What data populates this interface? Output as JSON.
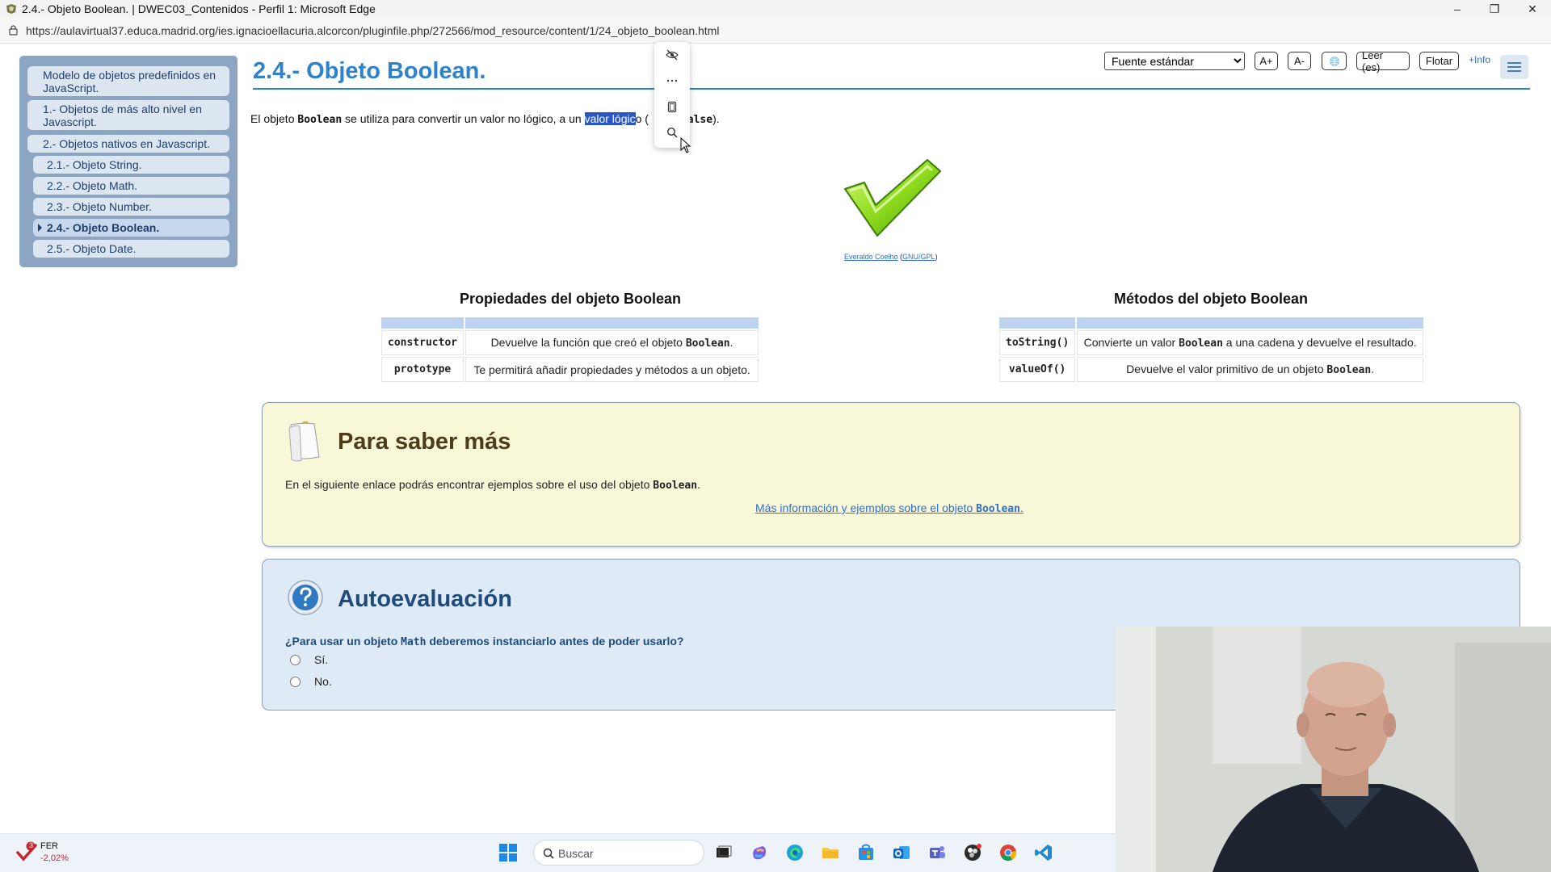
{
  "window": {
    "title": "2.4.- Objeto Boolean. | DWEC03_Contenidos - Perfil 1: Microsoft Edge",
    "minimize": "–",
    "maximize": "❐",
    "close": "✕"
  },
  "addressbar": {
    "url": "https://aulavirtual37.educa.madrid.org/ies.ignacioellacuria.alcorcon/pluginfile.php/272566/mod_resource/content/1/24_objeto_boolean.html"
  },
  "sidebar": {
    "items": [
      {
        "label": "Modelo de objetos predefinidos en JavaScript."
      },
      {
        "label": "1.- Objetos de más alto nivel en Javascript."
      },
      {
        "label": "2.- Objetos nativos en Javascript."
      },
      {
        "label": "2.1.- Objeto String."
      },
      {
        "label": "2.2.- Objeto Math."
      },
      {
        "label": "2.3.- Objeto Number."
      },
      {
        "label": "2.4.- Objeto Boolean."
      },
      {
        "label": "2.5.- Objeto Date."
      }
    ]
  },
  "header": {
    "title": "2.4.- Objeto Boolean.",
    "font_select": "Fuente estándar",
    "font_options": [
      "Fuente estándar"
    ],
    "btn_increase": "A+",
    "btn_decrease": "A-",
    "btn_read": "Leer (es)",
    "btn_float": "Flotar",
    "info_link": "+Info"
  },
  "intro": {
    "t1": "El objeto ",
    "c1": "Boolean",
    "t2": " se utiliza para convertir un valor no lógico, a un ",
    "selected": "valor lógic",
    "t3": "o (",
    "c2": "false",
    "t4": ")."
  },
  "image_credit": {
    "author": "Everaldo Coelho",
    "open": " (",
    "license": "GNU/GPL",
    "close": ")"
  },
  "properties": {
    "title": "Propiedades del objeto Boolean",
    "rows": [
      {
        "name": "constructor",
        "desc": "Devuelve la función que creó el objeto ",
        "code": "Boolean",
        "end": "."
      },
      {
        "name": "prototype",
        "desc": "Te permitirá añadir propiedades y métodos a un objeto.",
        "code": "",
        "end": ""
      }
    ]
  },
  "methods": {
    "title": "Métodos del objeto Boolean",
    "rows": [
      {
        "name": "toString()",
        "desc": "Convierte un valor ",
        "code": "Boolean",
        "end": " a una cadena y devuelve el resultado."
      },
      {
        "name": "valueOf()",
        "desc": "Devuelve el valor primitivo de un objeto ",
        "code": "Boolean",
        "end": "."
      }
    ]
  },
  "saber_mas": {
    "title": "Para saber más",
    "text": "En el siguiente enlace podrás encontrar ejemplos sobre el uso del objeto ",
    "text_code": "Boolean",
    "text_end": ".",
    "link": "Más información y ejemplos sobre el objeto ",
    "link_code": "Boolean",
    "link_end": "."
  },
  "autoevaluacion": {
    "title": "Autoevaluación",
    "question_a": "¿Para usar un objeto ",
    "question_code": "Math",
    "question_b": " deberemos instanciarlo antes de poder usarlo?",
    "options": [
      "Sí.",
      "No."
    ]
  },
  "taskbar": {
    "stock_badge": "3",
    "stock_name": "FER",
    "stock_change": "-2,02%",
    "search_placeholder": "Buscar"
  }
}
